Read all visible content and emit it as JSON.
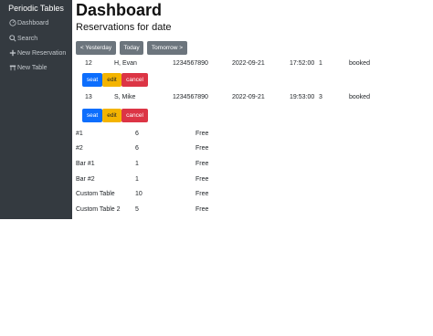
{
  "sidebar": {
    "brand": "Periodic Tables",
    "items": [
      {
        "label": "Dashboard",
        "icon": "dashboard-icon"
      },
      {
        "label": "Search",
        "icon": "search-icon"
      },
      {
        "label": "New Reservation",
        "icon": "plus-icon"
      },
      {
        "label": "New Table",
        "icon": "table-icon"
      }
    ]
  },
  "main": {
    "title": "Dashboard",
    "subtitle": "Reservations for date",
    "nav_buttons": {
      "previous": "< Yesterday",
      "today": "Today",
      "next": "Tomorrow >"
    }
  },
  "reservations": [
    {
      "id": "12",
      "name": "H, Evan",
      "phone": "1234567890",
      "date": "2022-09-21",
      "time": "17:52:00",
      "people": "1",
      "status": "booked",
      "actions": {
        "seat": "seat",
        "edit": "edit",
        "cancel": "cancel"
      }
    },
    {
      "id": "13",
      "name": "S, Mike",
      "phone": "1234567890",
      "date": "2022-09-21",
      "time": "19:53:00",
      "people": "3",
      "status": "booked",
      "actions": {
        "seat": "seat",
        "edit": "edit",
        "cancel": "cancel"
      }
    }
  ],
  "tables": [
    {
      "name": "#1",
      "capacity": "6",
      "status": "Free"
    },
    {
      "name": "#2",
      "capacity": "6",
      "status": "Free"
    },
    {
      "name": "Bar #1",
      "capacity": "1",
      "status": "Free"
    },
    {
      "name": "Bar #2",
      "capacity": "1",
      "status": "Free"
    },
    {
      "name": "Custom Table",
      "capacity": "10",
      "status": "Free"
    },
    {
      "name": "Custom Table 2",
      "capacity": "5",
      "status": "Free"
    }
  ],
  "colors": {
    "sidebar_bg": "#343a40",
    "seat_button": "#0d6efd",
    "edit_button": "#f4b400",
    "cancel_button": "#dc3545",
    "nav_button": "#6c757d"
  }
}
